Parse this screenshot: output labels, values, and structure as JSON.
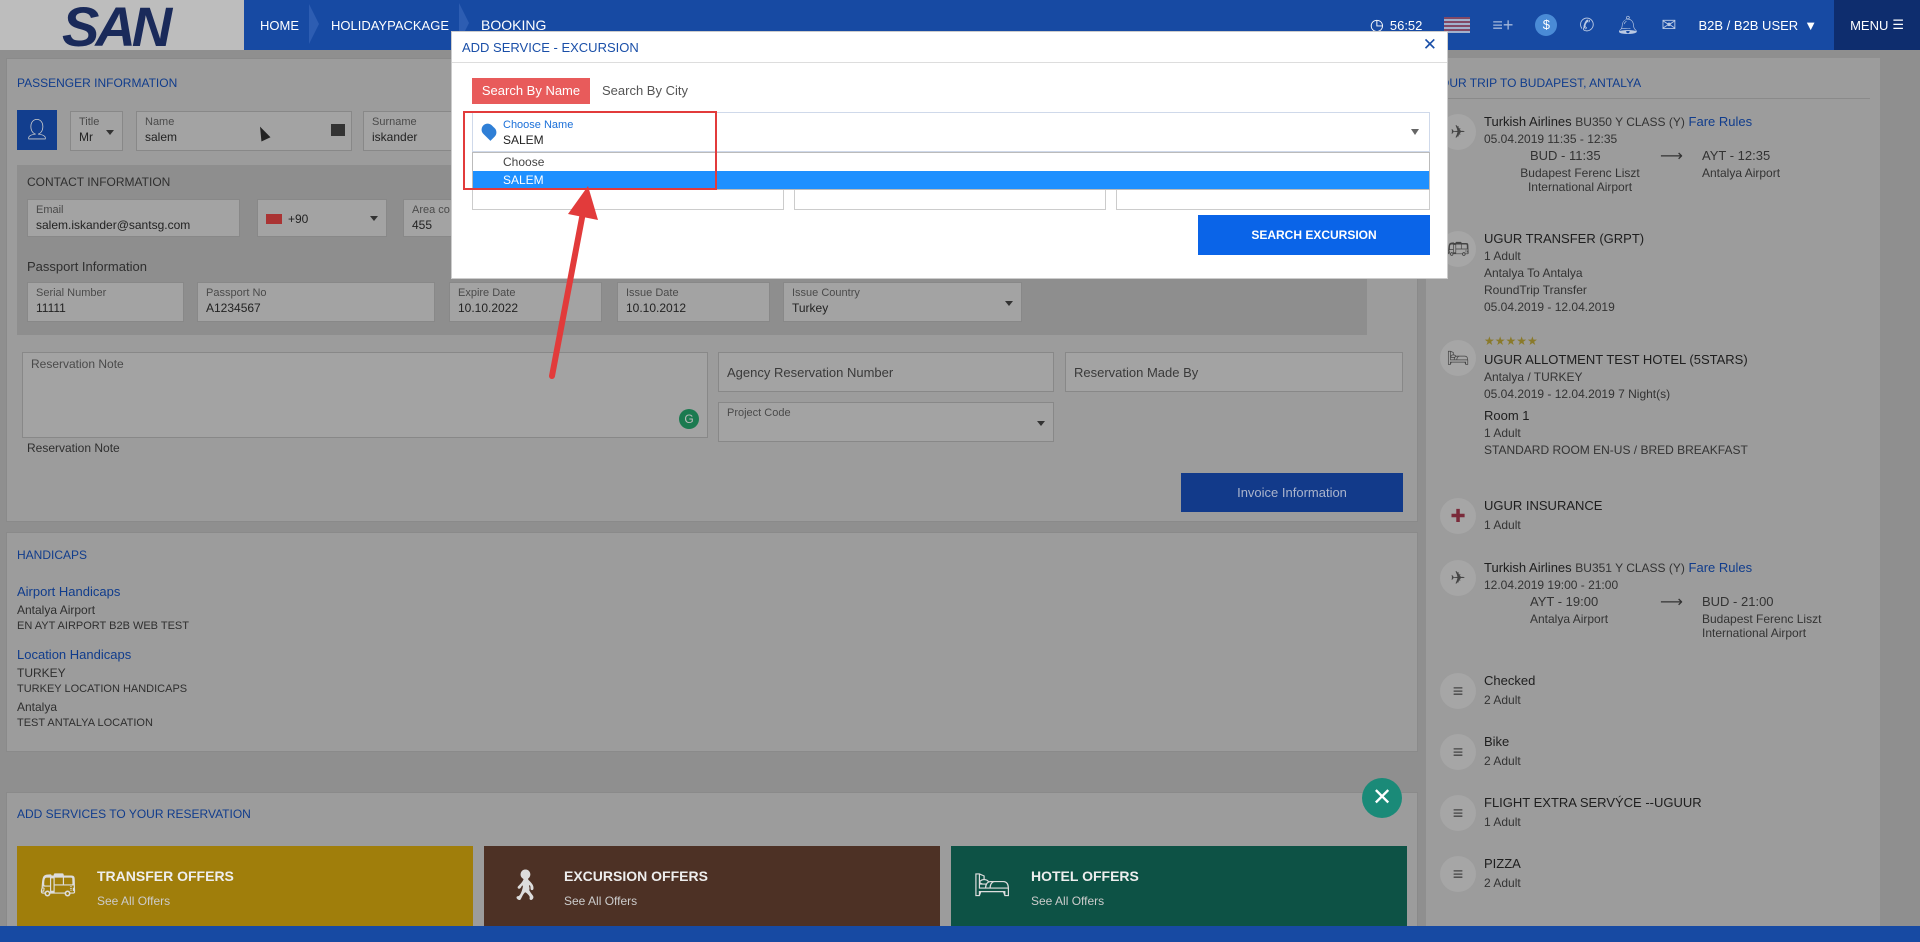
{
  "header": {
    "logo": "SAN",
    "breadcrumbs": [
      "HOME",
      "HOLIDAYPACKAGE",
      "BOOKING"
    ],
    "timer": "56:52",
    "user_menu": "B2B / B2B USER",
    "menu": "MENU"
  },
  "passenger": {
    "section_title": "PASSENGER INFORMATION",
    "title_label": "Title",
    "title_value": "Mr",
    "name_label": "Name",
    "name_value": "salem",
    "surname_label": "Surname",
    "surname_value": "iskander",
    "contact_title": "CONTACT INFORMATION",
    "email_label": "Email",
    "email_value": "salem.iskander@santsg.com",
    "phone_code": "+90",
    "area_label": "Area co",
    "area_value": "455",
    "passport_title": "Passport Information",
    "serial_label": "Serial Number",
    "serial_value": "11111",
    "passport_label": "Passport No",
    "passport_value": "A1234567",
    "expire_label": "Expire Date",
    "expire_value": "10.10.2022",
    "issue_label": "Issue Date",
    "issue_value": "10.10.2012",
    "country_label": "Issue Country",
    "country_value": "Turkey",
    "note_label": "Reservation Note",
    "note_caption": "Reservation Note",
    "agency_placeholder": "Agency Reservation Number",
    "made_by_placeholder": "Reservation Made By",
    "project_label": "Project Code",
    "invoice_button": "Invoice Information"
  },
  "handicaps": {
    "title": "HANDICAPS",
    "airport_title": "Airport Handicaps",
    "airport_name": "Antalya Airport",
    "airport_detail": "EN AYT AIRPORT B2B WEB TEST",
    "location_title": "Location Handicaps",
    "loc1_name": "TURKEY",
    "loc1_detail": "TURKEY LOCATION HANDICAPS",
    "loc2_name": "Antalya",
    "loc2_detail": "TEST ANTALYA LOCATION"
  },
  "services": {
    "title": "ADD SERVICES TO YOUR RESERVATION",
    "offers": [
      {
        "title": "TRANSFER OFFERS",
        "sub": "See All Offers",
        "color": "#a07e0b"
      },
      {
        "title": "EXCURSION OFFERS",
        "sub": "See All Offers",
        "color": "#4d3125"
      },
      {
        "title": "HOTEL OFFERS",
        "sub": "See All Offers",
        "color": "#0d5245"
      }
    ]
  },
  "trip": {
    "title": "OUR TRIP TO BUDAPEST, ANTALYA",
    "flight1": {
      "airline": "Turkish Airlines",
      "code": "BU350 Y CLASS (Y)",
      "fare_rules": "Fare Rules",
      "date": "05.04.2019 11:35 - 12:35",
      "dep": "BUD - 11:35",
      "arr": "AYT - 12:35",
      "dep_airport": "Budapest Ferenc Liszt International Airport",
      "arr_airport": "Antalya Airport"
    },
    "transfer": {
      "title": "UGUR TRANSFER (GRPT)",
      "l1": "1 Adult",
      "l2": "Antalya To Antalya",
      "l3": "RoundTrip Transfer",
      "l4": "05.04.2019 - 12.04.2019"
    },
    "hotel": {
      "stars": "★★★★★",
      "title": "UGUR ALLOTMENT TEST HOTEL (5STARS)",
      "l1": "Antalya / TURKEY",
      "l2": "05.04.2019 - 12.04.2019 7 Night(s)",
      "room": "Room 1",
      "l3": "1 Adult",
      "l4": "STANDARD ROOM EN-US / BRED BREAKFAST"
    },
    "insurance": {
      "title": "UGUR INSURANCE",
      "l1": "1 Adult"
    },
    "flight2": {
      "airline": "Turkish Airlines",
      "code": "BU351 Y CLASS (Y)",
      "fare_rules": "Fare Rules",
      "date": "12.04.2019 19:00 - 21:00",
      "dep": "AYT - 19:00",
      "arr": "BUD - 21:00",
      "dep_airport": "Antalya Airport",
      "arr_airport": "Budapest Ferenc Liszt International Airport"
    },
    "extras": [
      {
        "title": "Checked",
        "sub": "2 Adult"
      },
      {
        "title": "Bike",
        "sub": "2 Adult"
      },
      {
        "title": "FLIGHT EXTRA SERVÝCE --UGUUR",
        "sub": "1 Adult"
      },
      {
        "title": "PIZZA",
        "sub": "2 Adult"
      }
    ]
  },
  "modal": {
    "title": "ADD SERVICE - EXCURSION",
    "close": "✕",
    "tab_by_name": "Search By Name",
    "tab_by_city": "Search By City",
    "select_label": "Choose Name",
    "select_value": "SALEM",
    "options": [
      "Choose",
      "SALEM"
    ],
    "search_button": "SEARCH EXCURSION"
  }
}
